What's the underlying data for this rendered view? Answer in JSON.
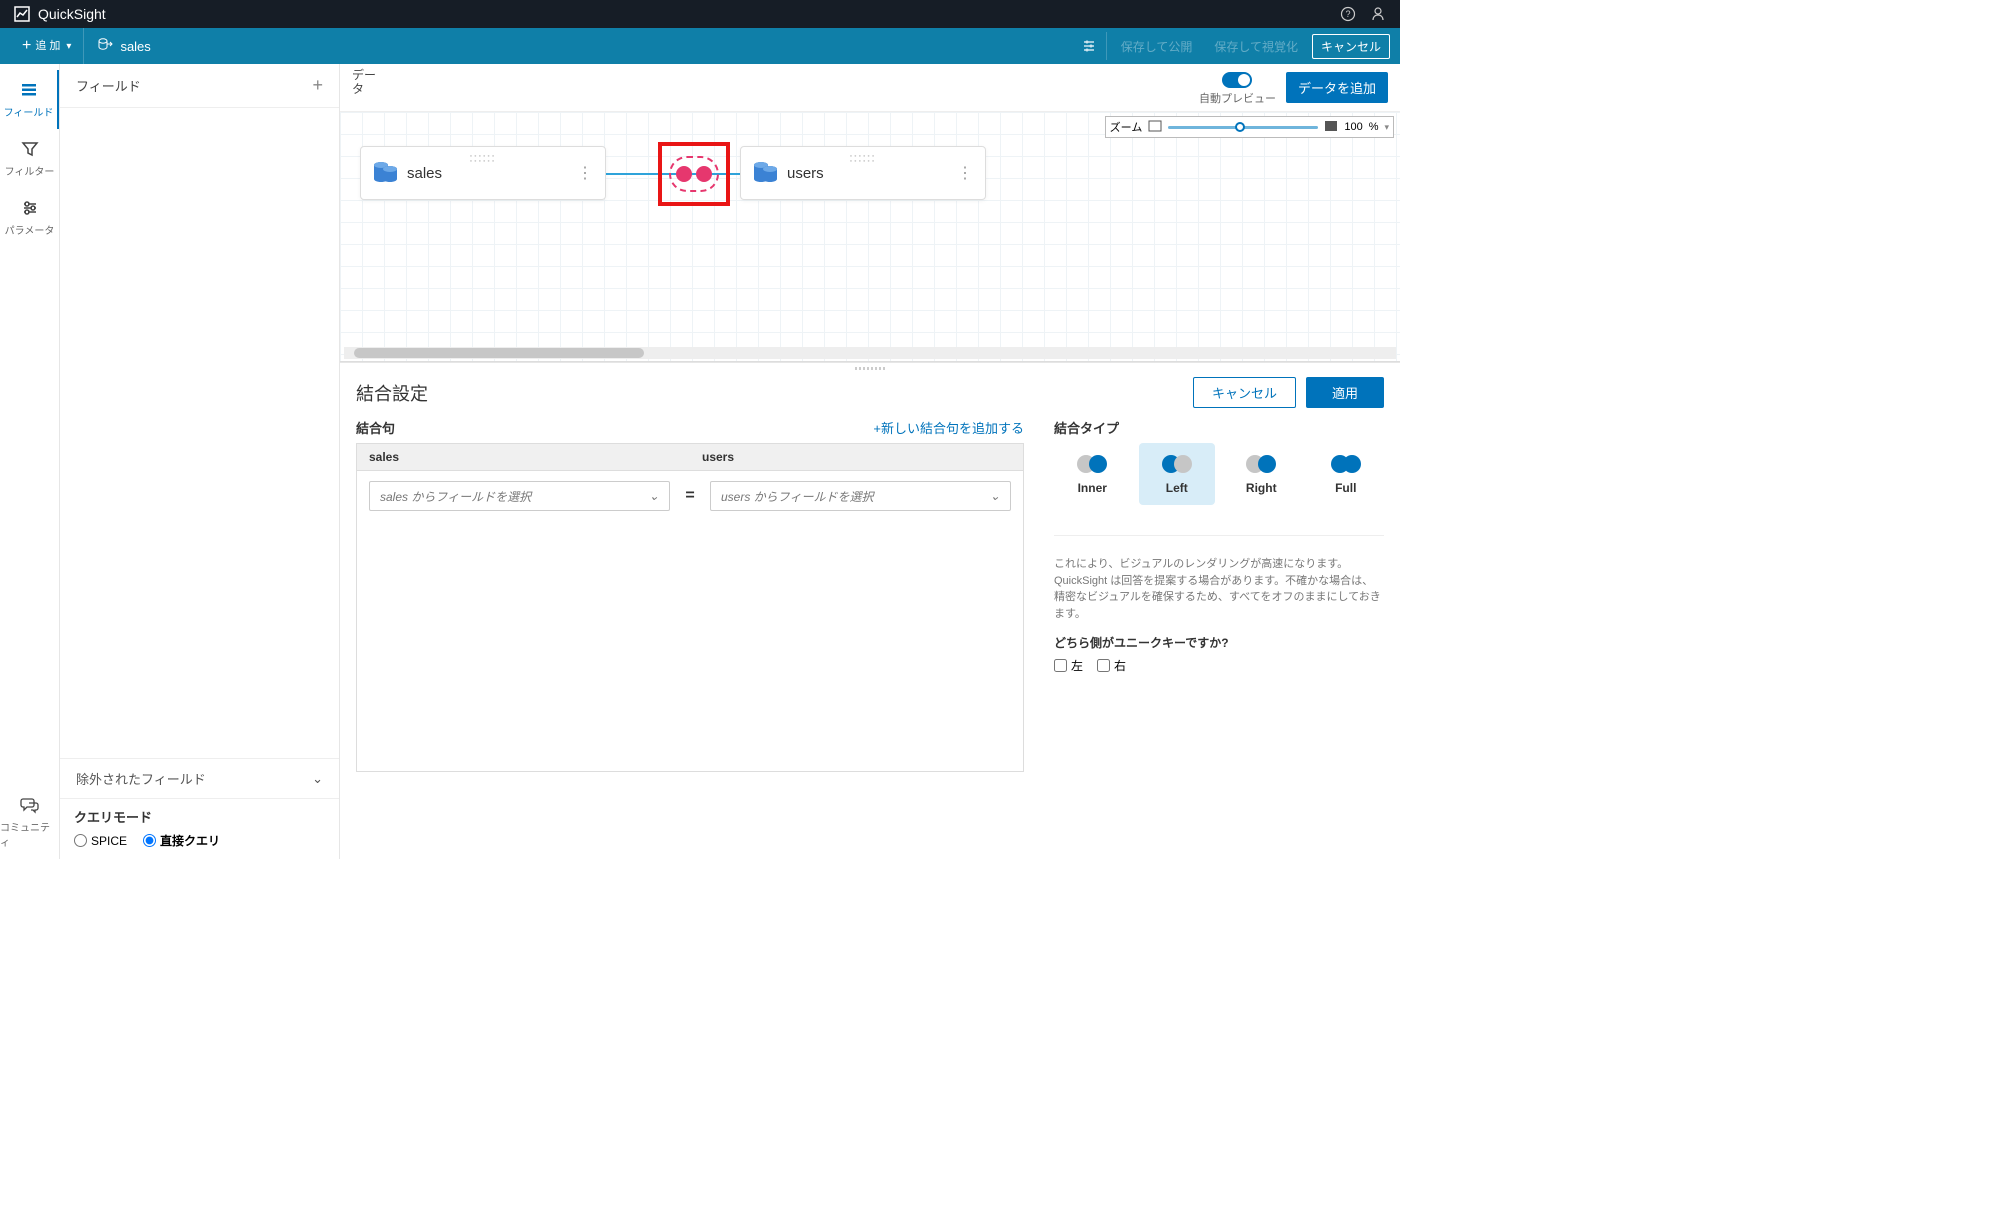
{
  "brand": "QuickSight",
  "top": {
    "help": "?",
    "user": "⚬"
  },
  "toolbar": {
    "add": "追 加",
    "dataset": "sales",
    "savePublish": "保存して公開",
    "saveVisualize": "保存して視覚化",
    "cancel": "キャンセル"
  },
  "nav": {
    "fields": "フィールド",
    "filter": "フィルター",
    "params": "パラメータ",
    "community": "コミュニティ"
  },
  "fieldsPanel": {
    "title": "フィールド",
    "excluded": "除外されたフィールド",
    "queryMode": "クエリモード",
    "spice": "SPICE",
    "direct": "直接クエリ"
  },
  "workspace": {
    "dataLabel": "データ",
    "autoPreview": "自動プレビュー",
    "addData": "データを追加",
    "zoomLabel": "ズーム",
    "zoomValue": "100",
    "zoomUnit": "%"
  },
  "nodes": {
    "left": "sales",
    "right": "users"
  },
  "join": {
    "title": "結合設定",
    "cancel": "キャンセル",
    "apply": "適用",
    "clauseTitle": "結合句",
    "addClause": "+新しい結合句を追加する",
    "leftCol": "sales",
    "rightCol": "users",
    "leftPlaceholder": "sales からフィールドを選択",
    "rightPlaceholder": "users からフィールドを選択",
    "typeTitle": "結合タイプ",
    "types": {
      "inner": "Inner",
      "left": "Left",
      "right": "Right",
      "full": "Full"
    },
    "helpText": "これにより、ビジュアルのレンダリングが高速になります。QuickSight は回答を提案する場合があります。不確かな場合は、精密なビジュアルを確保するため、すべてをオフのままにしておきます。",
    "uniqueQ": "どちら側がユニークキーですか?",
    "leftChk": "左",
    "rightChk": "右"
  }
}
